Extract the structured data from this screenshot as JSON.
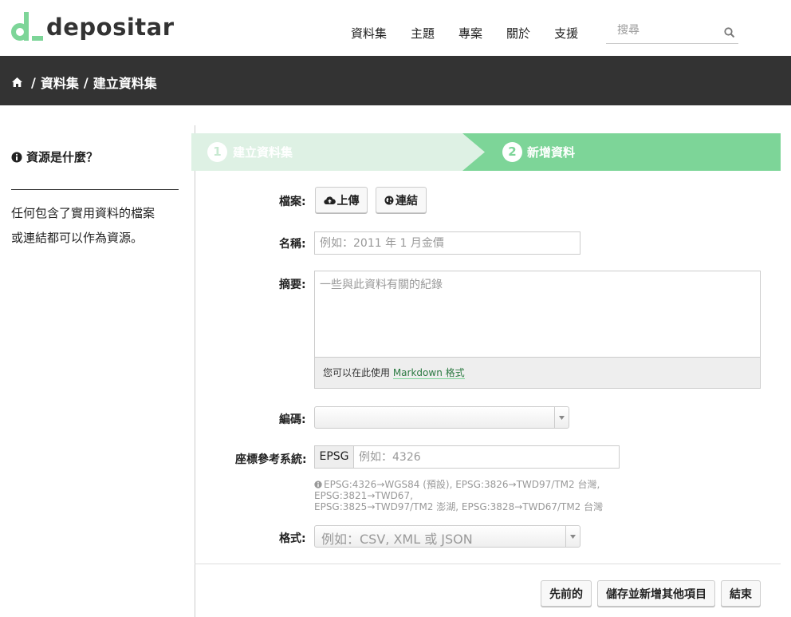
{
  "header": {
    "logo_text": "depositar",
    "nav": [
      "資料集",
      "主題",
      "專案",
      "關於",
      "支援"
    ],
    "search_placeholder": "搜尋",
    "accent_color": "#7dd598"
  },
  "breadcrumb": {
    "items": [
      "資料集",
      "建立資料集"
    ],
    "separator": "/"
  },
  "sidebar": {
    "title": "資源是什麼？",
    "body_line1": "任何包含了實用資料的檔案",
    "body_line2": "或連結都可以作為資源。"
  },
  "steps": [
    {
      "num": "1",
      "label": "建立資料集",
      "state": "completed"
    },
    {
      "num": "2",
      "label": "新增資料",
      "state": "active"
    }
  ],
  "form": {
    "file_label": "檔案:",
    "upload_label": "上傳",
    "link_label": "連結",
    "name_label": "名稱:",
    "name_placeholder": "例如：2011 年 1 月金價",
    "desc_label": "摘要:",
    "desc_placeholder": "一些與此資料有關的紀錄",
    "markdown_help_prefix": "您可以在此使用 ",
    "markdown_link": "Markdown 格式",
    "encoding_label": "編碼:",
    "encoding_value": "",
    "crs_label": "座標參考系統:",
    "crs_prefix": "EPSG",
    "crs_placeholder": "例如：4326",
    "crs_help_line1": "EPSG:4326→WGS84 (預設), EPSG:3826→TWD97/TM2 台灣, EPSG:3821→TWD67,",
    "crs_help_line2": "EPSG:3825→TWD97/TM2 澎湖, EPSG:3828→TWD67/TM2 台灣",
    "format_label": "格式:",
    "format_placeholder": "例如：CSV, XML 或 JSON"
  },
  "actions": {
    "previous": "先前的",
    "save_add": "儲存並新增其他項目",
    "finish": "結束"
  }
}
